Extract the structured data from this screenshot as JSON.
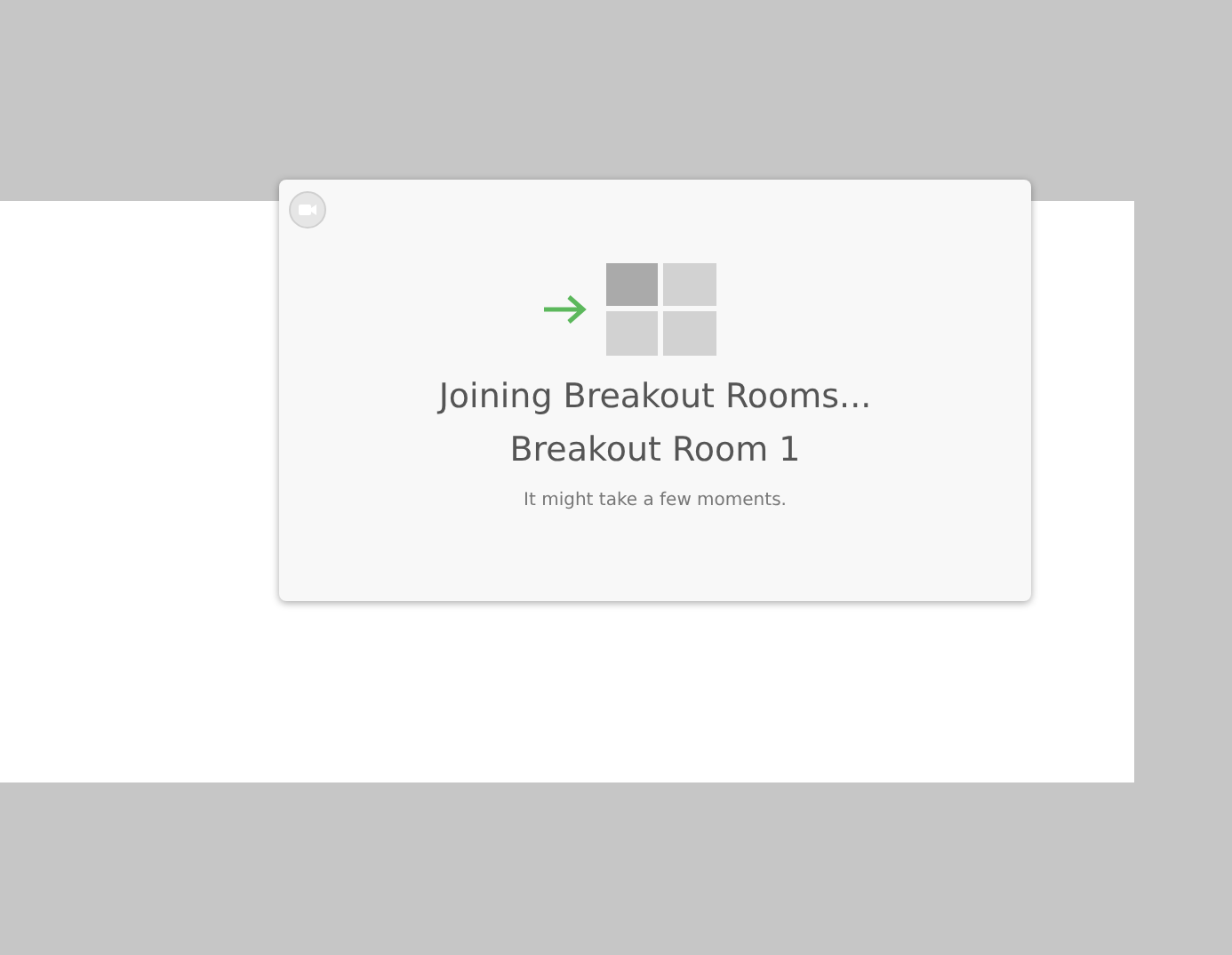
{
  "dialog": {
    "title": "Joining Breakout Rooms...",
    "room": "Breakout Room 1",
    "message": "It might take a few moments."
  }
}
